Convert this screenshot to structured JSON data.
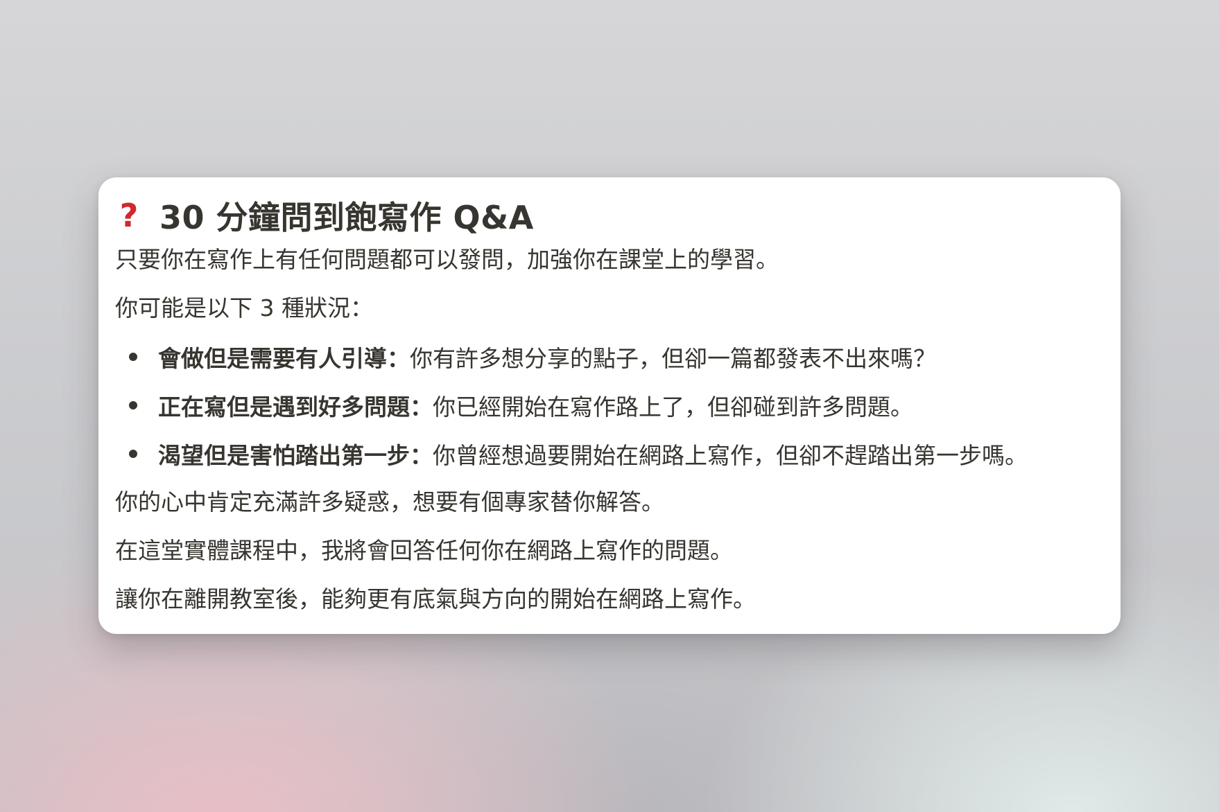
{
  "card": {
    "title_icon": "question-mark-icon",
    "title_icon_glyph": "?",
    "title_icon_color": "#d0282d",
    "title": "30 分鐘問到飽寫作 Q&A",
    "intro": "只要你在寫作上有任何問題都可以發問，加強你在課堂上的學習。",
    "situations_lead": "你可能是以下 3 種狀況：",
    "bullets": [
      {
        "bold": "會做但是需要有人引導：",
        "text": "你有許多想分享的點子，但卻一篇都發表不出來嗎？"
      },
      {
        "bold": "正在寫但是遇到好多問題：",
        "text": "你已經開始在寫作路上了，但卻碰到許多問題。"
      },
      {
        "bold": "渴望但是害怕踏出第一步：",
        "text": "你曾經想過要開始在網路上寫作，但卻不趕踏出第一步嗎。"
      }
    ],
    "closing": [
      "你的心中肯定充滿許多疑惑，想要有個專家替你解答。",
      "在這堂實體課程中，我將會回答任何你在網路上寫作的問題。",
      "讓你在離開教室後，能夠更有底氣與方向的開始在網路上寫作。"
    ]
  }
}
